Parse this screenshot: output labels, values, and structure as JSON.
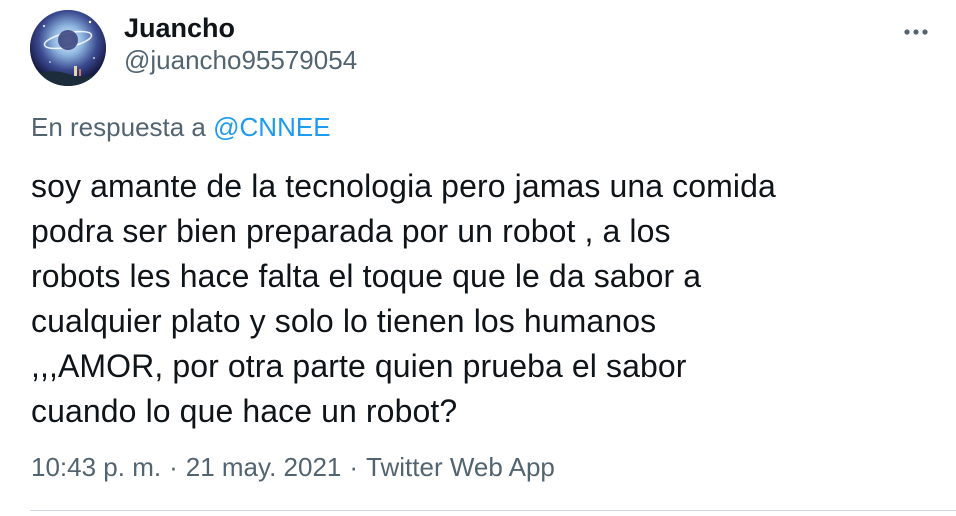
{
  "author": {
    "display_name": "Juancho",
    "handle": "@juancho95579054",
    "avatar_icon": "planet-avatar-icon"
  },
  "more_icon": "more-dots-icon",
  "reply_to": {
    "prefix": "En respuesta a",
    "mention": "@CNNEE"
  },
  "tweet_text": "soy amante de la tecnologia pero jamas una comida\npodra ser bien preparada por un robot , a los\nrobots les hace falta el toque que le da sabor a\ncualquier plato y solo lo tienen los humanos\n,,,AMOR, por otra parte quien prueba el sabor\ncuando lo que hace un robot?",
  "meta": {
    "time": "10:43 p. m.",
    "separator": "·",
    "date": "21 may. 2021",
    "source": "Twitter Web App"
  },
  "colors": {
    "text": "#0f1419",
    "secondary": "#536471",
    "link": "#1d9bf0",
    "divider": "#cfd9de"
  }
}
